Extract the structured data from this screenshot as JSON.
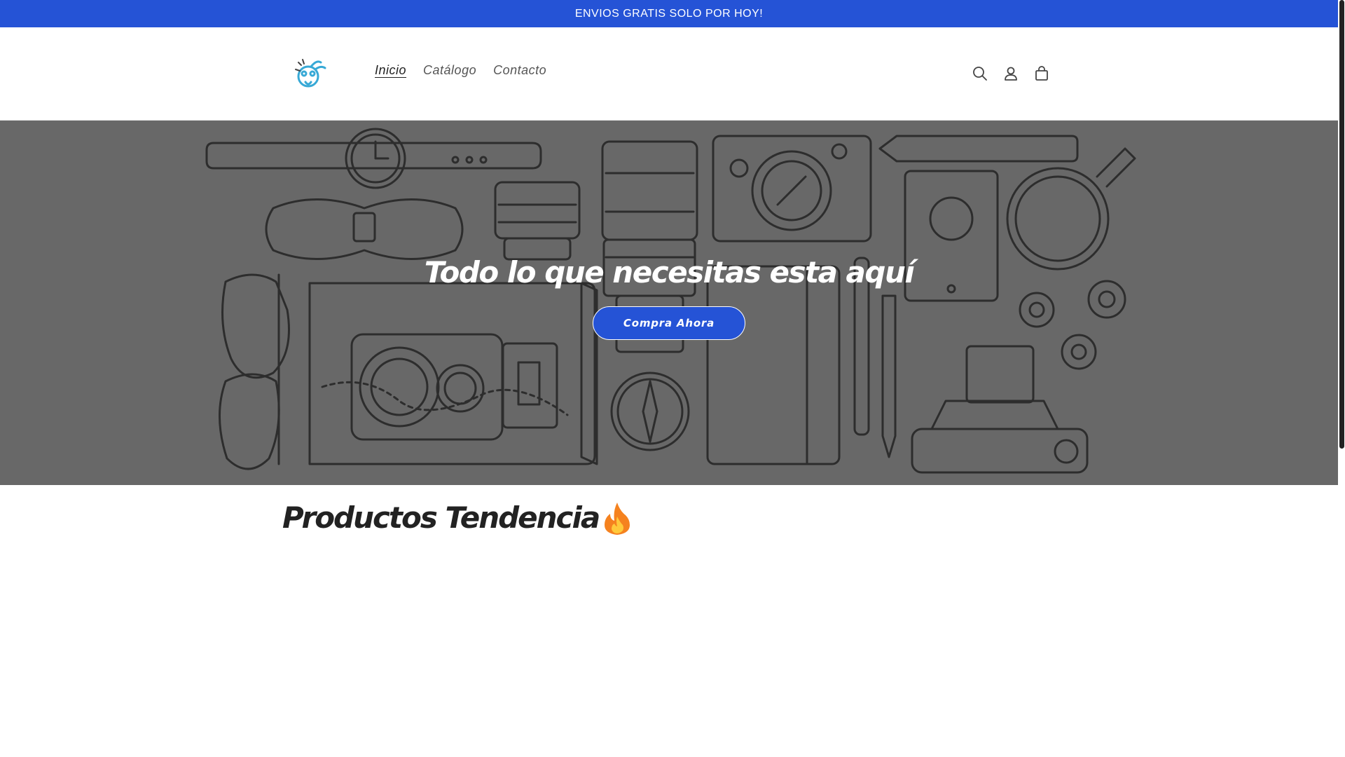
{
  "announcement": {
    "text": "ENVIOS GRATIS SOLO POR HOY!"
  },
  "header": {
    "logo_icon": "koala-logo-icon",
    "nav": [
      {
        "label": "Inicio",
        "active": true
      },
      {
        "label": "Catálogo",
        "active": false
      },
      {
        "label": "Contacto",
        "active": false
      }
    ],
    "icons": [
      "search-icon",
      "account-icon",
      "cart-icon"
    ]
  },
  "hero": {
    "title": "Todo lo que necesitas esta aquí",
    "button_label": "Compra Ahora"
  },
  "products": {
    "title": "Productos Tendencia"
  },
  "colors": {
    "accent": "#2553d6",
    "hero_bg": "#6b6b6b",
    "line_art": "#2b2b2b"
  }
}
